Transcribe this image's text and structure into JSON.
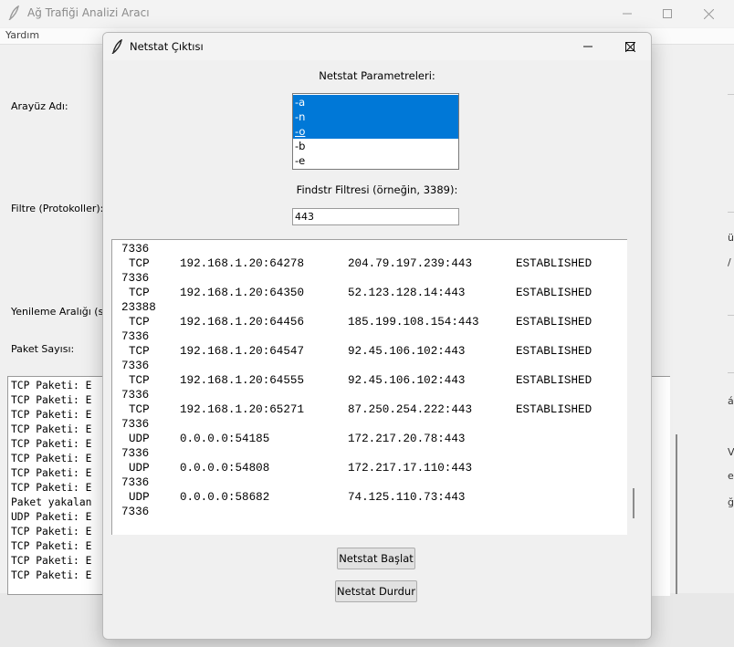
{
  "main_window": {
    "title": "Ağ Trafiği Analizi Aracı",
    "menu": [
      "Yardım"
    ],
    "labels": {
      "interface": "Arayüz Adı:",
      "filter": "Filtre (Protokoller):",
      "refresh": "Yenileme Aralığı (sa",
      "packet_count": "Paket Sayısı:"
    },
    "log_lines": [
      "TCP Paketi: E",
      "TCP Paketi: E",
      "TCP Paketi: E",
      "TCP Paketi: E",
      "TCP Paketi: E",
      "TCP Paketi: E",
      "TCP Paketi: E",
      "TCP Paketi: E",
      "Paket yakalan",
      "UDP Paketi: E",
      "TCP Paketi: E",
      "TCP Paketi: E",
      "TCP Paketi: E",
      "TCP Paketi: E"
    ],
    "edge_glyphs": [
      "ü",
      "/",
      "á",
      "V",
      "e",
      "ğ"
    ]
  },
  "dialog": {
    "title": "Netstat Çıktısı",
    "params_label": "Netstat Parametreleri:",
    "params": [
      {
        "label": "-a",
        "selected": true
      },
      {
        "label": "-n",
        "selected": true
      },
      {
        "label": "-o",
        "selected": true
      },
      {
        "label": "-b",
        "selected": false
      },
      {
        "label": "-e",
        "selected": false
      }
    ],
    "findstr_label": "Findstr Filtresi (örneğin, 3389):",
    "findstr_value": "443",
    "output_top_pid": "7336",
    "connections": [
      {
        "proto": "TCP",
        "local": "192.168.1.20:64278",
        "foreign": "204.79.197.239:443",
        "state": "ESTABLISHED",
        "pid": "7336"
      },
      {
        "proto": "TCP",
        "local": "192.168.1.20:64350",
        "foreign": "52.123.128.14:443",
        "state": "ESTABLISHED",
        "pid": "23388"
      },
      {
        "proto": "TCP",
        "local": "192.168.1.20:64456",
        "foreign": "185.199.108.154:443",
        "state": "ESTABLISHED",
        "pid": "7336"
      },
      {
        "proto": "TCP",
        "local": "192.168.1.20:64547",
        "foreign": "92.45.106.102:443",
        "state": "ESTABLISHED",
        "pid": "7336"
      },
      {
        "proto": "TCP",
        "local": "192.168.1.20:64555",
        "foreign": "92.45.106.102:443",
        "state": "ESTABLISHED",
        "pid": "7336"
      },
      {
        "proto": "TCP",
        "local": "192.168.1.20:65271",
        "foreign": "87.250.254.222:443",
        "state": "ESTABLISHED",
        "pid": "7336"
      },
      {
        "proto": "UDP",
        "local": "0.0.0.0:54185",
        "foreign": "172.217.20.78:443",
        "state": "",
        "pid": "7336"
      },
      {
        "proto": "UDP",
        "local": "0.0.0.0:54808",
        "foreign": "172.217.17.110:443",
        "state": "",
        "pid": "7336"
      },
      {
        "proto": "UDP",
        "local": "0.0.0.0:58682",
        "foreign": "74.125.110.73:443",
        "state": "",
        "pid": "7336"
      }
    ],
    "start_button": "Netstat Başlat",
    "stop_button": "Netstat Durdur"
  },
  "colors": {
    "selection": "#0078d7",
    "window_bg": "#f0f0f0"
  },
  "icons": [
    "feather-icon",
    "minimize-icon",
    "maximize-icon",
    "close-icon"
  ]
}
